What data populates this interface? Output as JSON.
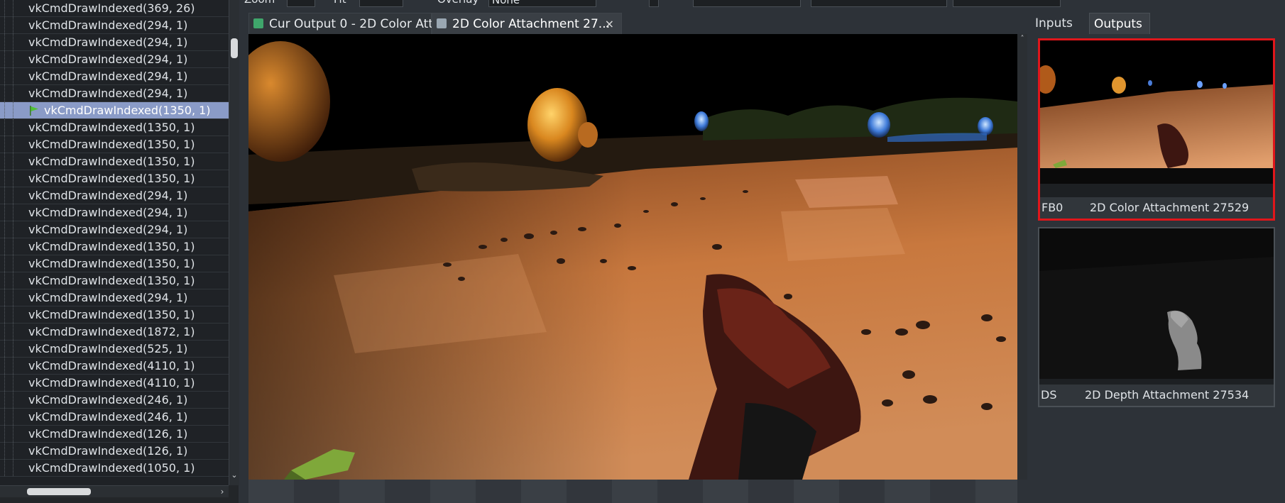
{
  "event_list": {
    "items": [
      {
        "label": "vkCmdDrawIndexed(369, 26)"
      },
      {
        "label": "vkCmdDrawIndexed(294, 1)"
      },
      {
        "label": "vkCmdDrawIndexed(294, 1)"
      },
      {
        "label": "vkCmdDrawIndexed(294, 1)"
      },
      {
        "label": "vkCmdDrawIndexed(294, 1)"
      },
      {
        "label": "vkCmdDrawIndexed(294, 1)"
      },
      {
        "label": "vkCmdDrawIndexed(1350, 1)",
        "selected": true
      },
      {
        "label": "vkCmdDrawIndexed(1350, 1)"
      },
      {
        "label": "vkCmdDrawIndexed(1350, 1)"
      },
      {
        "label": "vkCmdDrawIndexed(1350, 1)"
      },
      {
        "label": "vkCmdDrawIndexed(1350, 1)"
      },
      {
        "label": "vkCmdDrawIndexed(294, 1)"
      },
      {
        "label": "vkCmdDrawIndexed(294, 1)"
      },
      {
        "label": "vkCmdDrawIndexed(294, 1)"
      },
      {
        "label": "vkCmdDrawIndexed(1350, 1)"
      },
      {
        "label": "vkCmdDrawIndexed(1350, 1)"
      },
      {
        "label": "vkCmdDrawIndexed(1350, 1)"
      },
      {
        "label": "vkCmdDrawIndexed(294, 1)"
      },
      {
        "label": "vkCmdDrawIndexed(1350, 1)"
      },
      {
        "label": "vkCmdDrawIndexed(1872, 1)"
      },
      {
        "label": "vkCmdDrawIndexed(525, 1)"
      },
      {
        "label": "vkCmdDrawIndexed(4110, 1)"
      },
      {
        "label": "vkCmdDrawIndexed(4110, 1)"
      },
      {
        "label": "vkCmdDrawIndexed(246, 1)"
      },
      {
        "label": "vkCmdDrawIndexed(246, 1)"
      },
      {
        "label": "vkCmdDrawIndexed(126, 1)"
      },
      {
        "label": "vkCmdDrawIndexed(126, 1)"
      },
      {
        "label": "vkCmdDrawIndexed(1050, 1)"
      }
    ]
  },
  "toolbar": {
    "zoom_label": "Zoom",
    "fit_label": "Fit",
    "overlay_label": "Overlay",
    "overlay_value": "None"
  },
  "tabs": {
    "current": "Cur Output 0 - 2D Color Att...",
    "attachment": "2D Color Attachment 27...",
    "close_glyph": "×"
  },
  "right_panel": {
    "tab_inputs": "Inputs",
    "tab_outputs": "Outputs",
    "thumbnails": [
      {
        "slot": "FB0",
        "name": "2D Color Attachment 27529"
      },
      {
        "slot": "DS",
        "name": "2D Depth Attachment 27534"
      }
    ]
  },
  "icons": {
    "flag": "flag-icon",
    "tab_output": "texture-output-icon",
    "tab_attachment": "texture-attachment-icon"
  },
  "colors": {
    "selection": "#8a9bc7",
    "active_thumbnail_border": "#e0161b"
  }
}
